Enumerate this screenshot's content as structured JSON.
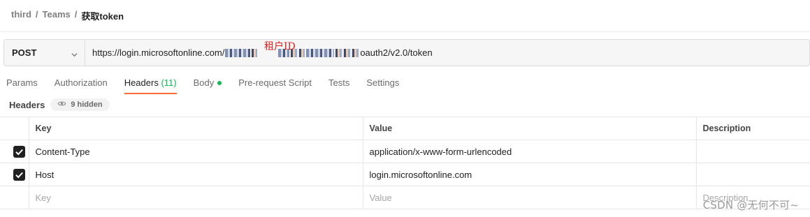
{
  "breadcrumb": {
    "items": [
      "third",
      "Teams",
      "获取token"
    ],
    "separator": "/"
  },
  "request": {
    "method": "POST",
    "url_prefix": "https://login.microsoftonline.com/",
    "url_suffix": "oauth2/v2.0/token",
    "annotation": "租户ID"
  },
  "tabs": [
    {
      "label": "Params"
    },
    {
      "label": "Authorization"
    },
    {
      "label": "Headers",
      "count": "(11)",
      "active": true
    },
    {
      "label": "Body"
    },
    {
      "label": "Pre-request Script"
    },
    {
      "label": "Tests"
    },
    {
      "label": "Settings"
    }
  ],
  "headers_section": {
    "title": "Headers",
    "hidden_label": "9 hidden"
  },
  "table": {
    "columns": [
      "Key",
      "Value",
      "Description"
    ],
    "rows": [
      {
        "key": "Content-Type",
        "value": "application/x-www-form-urlencoded",
        "description": "",
        "checked": true
      },
      {
        "key": "Host",
        "value": "login.microsoftonline.com",
        "description": "",
        "checked": true
      }
    ],
    "placeholder": {
      "key": "Key",
      "value": "Value",
      "description": "Description"
    }
  },
  "watermark": "CSDN @无何不可~",
  "colors": {
    "accent": "#ff6c37",
    "count": "#0cbb52",
    "annotation": "#e02020"
  },
  "icons": [
    "chevron-down-icon",
    "eye-icon",
    "checkbox-checked-icon"
  ]
}
